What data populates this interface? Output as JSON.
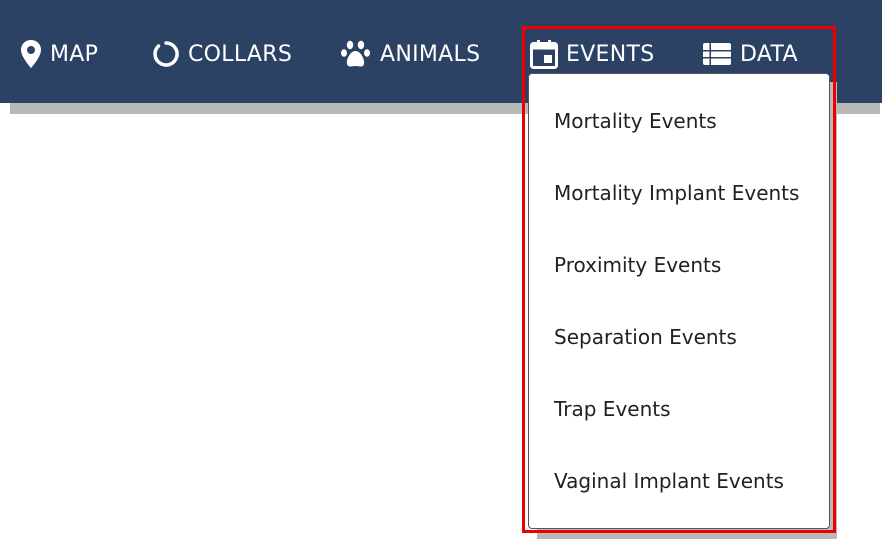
{
  "nav": {
    "items": [
      {
        "label": "MAP",
        "icon": "map-pin-icon"
      },
      {
        "label": "COLLARS",
        "icon": "collar-ring-icon"
      },
      {
        "label": "ANIMALS",
        "icon": "paw-icon"
      },
      {
        "label": "EVENTS",
        "icon": "calendar-icon"
      },
      {
        "label": "DATA",
        "icon": "data-list-icon"
      }
    ]
  },
  "events_menu": {
    "items": [
      "Mortality Events",
      "Mortality Implant Events",
      "Proximity Events",
      "Separation Events",
      "Trap Events",
      "Vaginal Implant Events"
    ]
  },
  "colors": {
    "navbar_bg": "#2c4265",
    "nav_text": "#ffffff",
    "highlight": "#ee0000",
    "shadow": "#b9b9b9"
  }
}
